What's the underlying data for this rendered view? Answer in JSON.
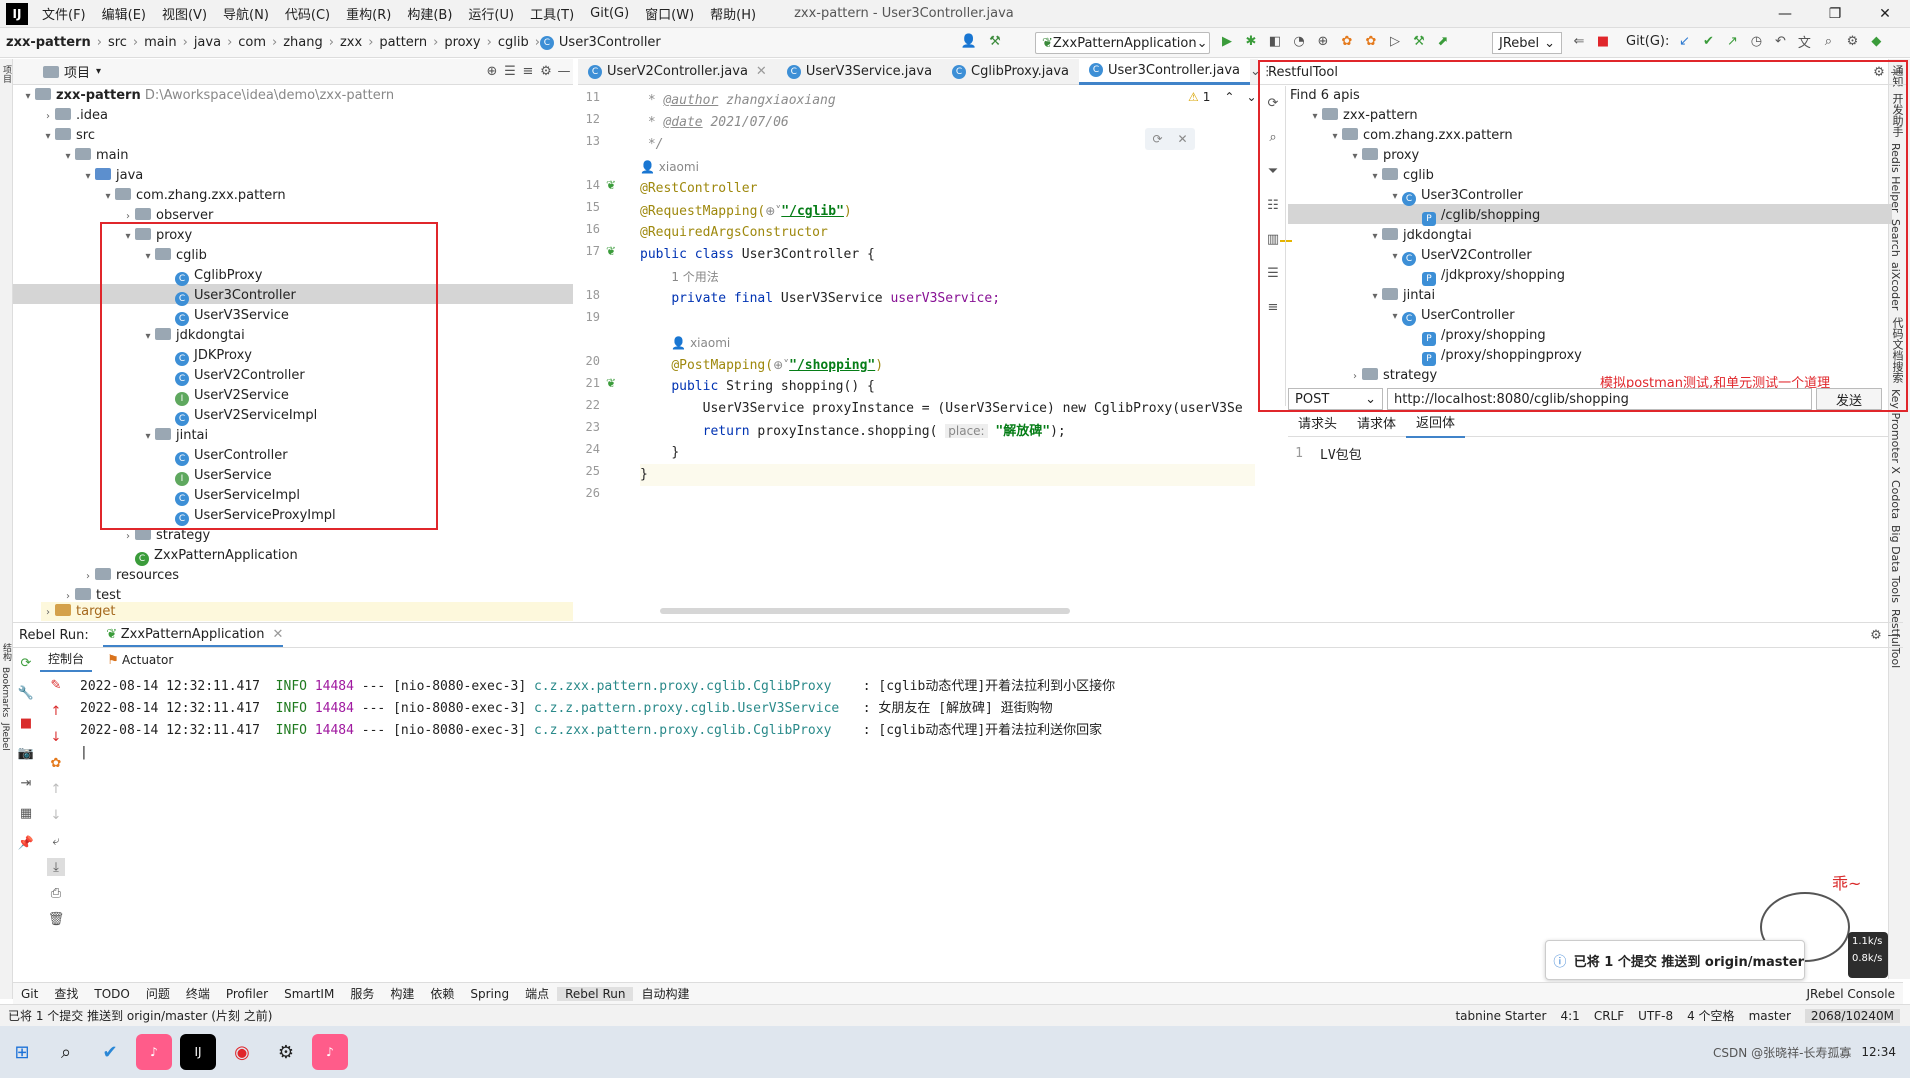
{
  "menubar": {
    "items": [
      "文件(F)",
      "编辑(E)",
      "视图(V)",
      "导航(N)",
      "代码(C)",
      "重构(R)",
      "构建(B)",
      "运行(U)",
      "工具(T)",
      "Git(G)",
      "窗口(W)",
      "帮助(H)"
    ],
    "title": "zxx-pattern - User3Controller.java"
  },
  "navbar": {
    "crumbs": [
      "zxx-pattern",
      "src",
      "main",
      "java",
      "com",
      "zhang",
      "zxx",
      "pattern",
      "proxy",
      "cglib",
      "User3Controller"
    ],
    "run_config": "ZxxPatternApplication",
    "jrebel": "JRebel",
    "git_label": "Git(G):"
  },
  "project": {
    "title": "项目",
    "root_name": "zxx-pattern",
    "root_path": "D:\\Aworkspace\\idea\\demo\\zxx-pattern",
    "nodes": [
      ".idea",
      "src",
      "main",
      "java",
      "com.zhang.zxx.pattern",
      "observer",
      "proxy",
      "cglib",
      "CglibProxy",
      "User3Controller",
      "UserV3Service",
      "jdkdongtai",
      "JDKProxy",
      "UserV2Controller",
      "UserV2Service",
      "UserV2ServiceImpl",
      "jintai",
      "UserController",
      "UserService",
      "UserServiceImpl",
      "UserServiceProxyImpl",
      "strategy",
      "ZxxPatternApplication",
      "resources",
      "test",
      "target"
    ]
  },
  "editor": {
    "tabs": [
      "UserV2Controller.java",
      "UserV3Service.java",
      "CglibProxy.java",
      "User3Controller.java"
    ],
    "warning_count": "1",
    "lines": [
      "11",
      "12",
      "13",
      "14",
      "15",
      "16",
      "17",
      "18",
      "19",
      "20",
      "21",
      "22",
      "23",
      "24",
      "25",
      "26"
    ],
    "author_tag": "@author",
    "author": "zhangxiaoxiang",
    "date_tag": "@date",
    "date": "2021/07/06",
    "comment_end": "*/",
    "star": "*",
    "user_hint": "xiaomi",
    "usage_hint": "1 个用法",
    "ann_rest": "@RestController",
    "ann_reqmap": "@RequestMapping(",
    "reqmap_path": "\"/cglib\"",
    "ann_args": "@RequiredArgsConstructor",
    "class_kw": "public class",
    "class_name": "User3Controller {",
    "field_kw": "private final",
    "field_type": "UserV3Service",
    "field_name": "userV3Service;",
    "ann_post": "@PostMapping(",
    "post_path": "\"/shopping\"",
    "method_kw": "public",
    "method_sig": "String shopping() {",
    "line22": "UserV3Service proxyInstance = (UserV3Service) new CglibProxy(userV3Se",
    "return_kw": "return",
    "line23a": "proxyInstance.shopping(",
    "param_hint": "place:",
    "line23b": "\"解放碑\"",
    "line23c": ");",
    "close1": "}",
    "close2": "}"
  },
  "restful": {
    "title": "RestfulTool",
    "find": "Find 6 apis",
    "tree": [
      "zxx-pattern",
      "com.zhang.zxx.pattern",
      "proxy",
      "cglib",
      "User3Controller",
      "/cglib/shopping",
      "jdkdongtai",
      "UserV2Controller",
      "/jdkproxy/shopping",
      "jintai",
      "UserController",
      "/proxy/shopping",
      "/proxy/shoppingproxy",
      "strategy"
    ],
    "note": "模拟postman测试,和单元测试一个道理",
    "method": "POST",
    "url": "http://localhost:8080/cglib/shopping",
    "send": "发送",
    "tabs": [
      "请求头",
      "请求体",
      "返回体"
    ],
    "response_line": "1",
    "response": "LV包包"
  },
  "run": {
    "label": "Rebel Run:",
    "config": "ZxxPatternApplication",
    "subtabs": [
      "控制台",
      "Actuator"
    ],
    "logs": [
      {
        "time": "2022-08-14 12:32:11.417",
        "level": "INFO",
        "pid": "14484",
        "thread": "--- [nio-8080-exec-3]",
        "logger": "c.z.zxx.pattern.proxy.cglib.CglibProxy   ",
        "msg": ": [cglib动态代理]开着法拉利到小区接你"
      },
      {
        "time": "2022-08-14 12:32:11.417",
        "level": "INFO",
        "pid": "14484",
        "thread": "--- [nio-8080-exec-3]",
        "logger": "c.z.z.pattern.proxy.cglib.UserV3Service  ",
        "msg": ": 女朋友在 [解放碑] 逛街购物"
      },
      {
        "time": "2022-08-14 12:32:11.417",
        "level": "INFO",
        "pid": "14484",
        "thread": "--- [nio-8080-exec-3]",
        "logger": "c.z.zxx.pattern.proxy.cglib.CglibProxy   ",
        "msg": ": [cglib动态代理]开着法拉利送你回家"
      }
    ]
  },
  "tooltabs": [
    "Git",
    "查找",
    "TODO",
    "问题",
    "终端",
    "Profiler",
    "SmartIM",
    "服务",
    "构建",
    "依赖",
    "Spring",
    "端点",
    "Rebel Run",
    "自动构建",
    "JRebel Console"
  ],
  "notification": "已将 1 个提交 推送到 origin/master",
  "status": {
    "left": "已将 1 个提交 推送到 origin/master (片刻 之前)",
    "tabnine": "tabnine Starter",
    "pos": "4:1",
    "crlf": "CRLF",
    "enc": "UTF-8",
    "indent": "4 个空格",
    "branch": "master",
    "mem": "2068/10240M"
  },
  "rightbar": [
    "通知",
    "开发助手",
    "Redis Helper",
    "Search",
    "aiXcoder",
    "代码文档搜索",
    "Key Promoter X",
    "Codota",
    "Big Data Tools",
    "RestfulTool"
  ],
  "leftbar": [
    "项目",
    "结构",
    "Bookmarks",
    "JRebel"
  ],
  "net": {
    "up": "1.1k/s",
    "down": "0.8k/s"
  },
  "mascot_text": "乖~",
  "taskbar": {
    "clock": "12:34",
    "watermark": "CSDN @张晓祥-长寿孤寡"
  }
}
